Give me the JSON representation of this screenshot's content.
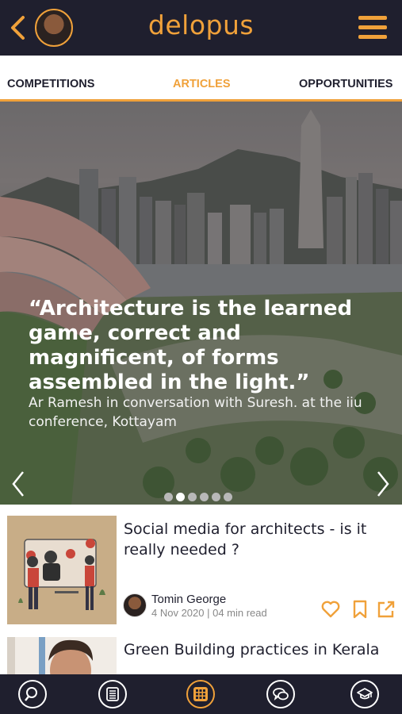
{
  "header": {
    "brand": "delopus",
    "back_icon": "chevron-left-icon",
    "menu_icon": "hamburger-icon",
    "accent": "#f0a13a",
    "background": "#1f1f2e"
  },
  "tabs": [
    {
      "label": "COMPETITIONS",
      "active": false
    },
    {
      "label": "ARTICLES",
      "active": true
    },
    {
      "label": "OPPORTUNITIES",
      "active": false
    }
  ],
  "hero": {
    "quote": "“Architecture is the learned game, correct and magnificent, of forms assembled in the light.”",
    "caption": "Ar Ramesh in conversation with Suresh. at the iiu conference, Kottayam",
    "slide_count": 6,
    "active_slide": 2
  },
  "articles": [
    {
      "title": "Social media for architects -  is it really needed ?",
      "author": "Tomin George",
      "meta": "4 Nov 2020 | 04 min read",
      "actions": [
        "heart-icon",
        "bookmark-icon",
        "share-icon"
      ]
    },
    {
      "title": "Green Building practices in Kerala"
    }
  ],
  "bottom_nav": [
    {
      "icon": "search-icon",
      "active": false
    },
    {
      "icon": "document-icon",
      "active": false
    },
    {
      "icon": "grid-icon",
      "active": true
    },
    {
      "icon": "chat-icon",
      "active": false
    },
    {
      "icon": "graduation-cap-icon",
      "active": false
    }
  ]
}
